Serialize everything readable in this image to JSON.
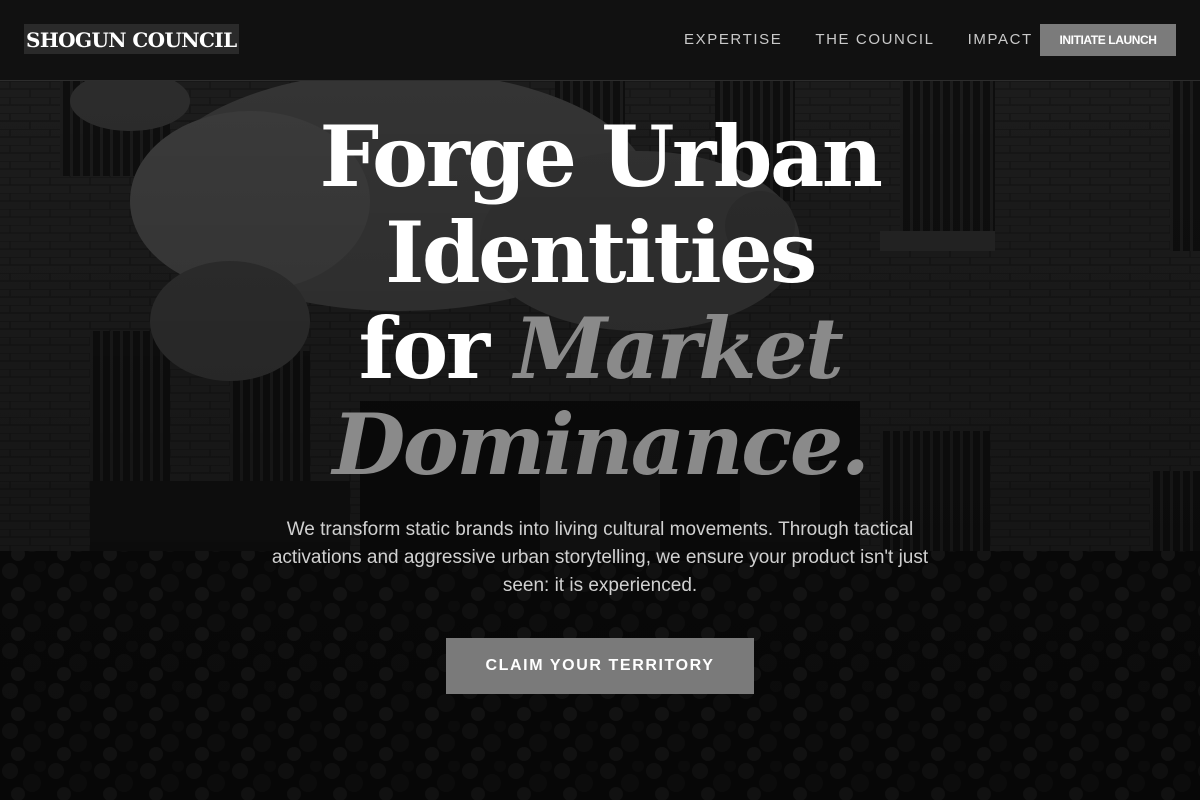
{
  "nav": {
    "brand": "SHOGUN COUNCIL",
    "links": [
      {
        "label": "EXPERTISE"
      },
      {
        "label": "THE COUNCIL"
      },
      {
        "label": "IMPACT"
      }
    ],
    "cta_label": "INITIATE LAUNCH"
  },
  "hero": {
    "headline": {
      "line1": "Forge Urban",
      "line2": "Identities",
      "line3_plain": "for",
      "line3_accent": "Market",
      "line4_accent": "Dominance."
    },
    "subtext": "We transform static brands into living cultural movements. Through tactical activations and aggressive urban storytelling, we ensure your product isn't just seen: it is experienced.",
    "cta_label": "CLAIM YOUR TERRITORY",
    "background": {
      "description": "Grayscale photo of a crowded brick courtyard with an inflatable figure and a branded activation booth",
      "overlay_color": "#000000"
    }
  },
  "colors": {
    "nav_background": "#111111",
    "text_primary": "#ffffff",
    "text_accent": "#8a8a8a",
    "button_background": "#7a7a7a",
    "nav_link": "#c9c9c9"
  }
}
